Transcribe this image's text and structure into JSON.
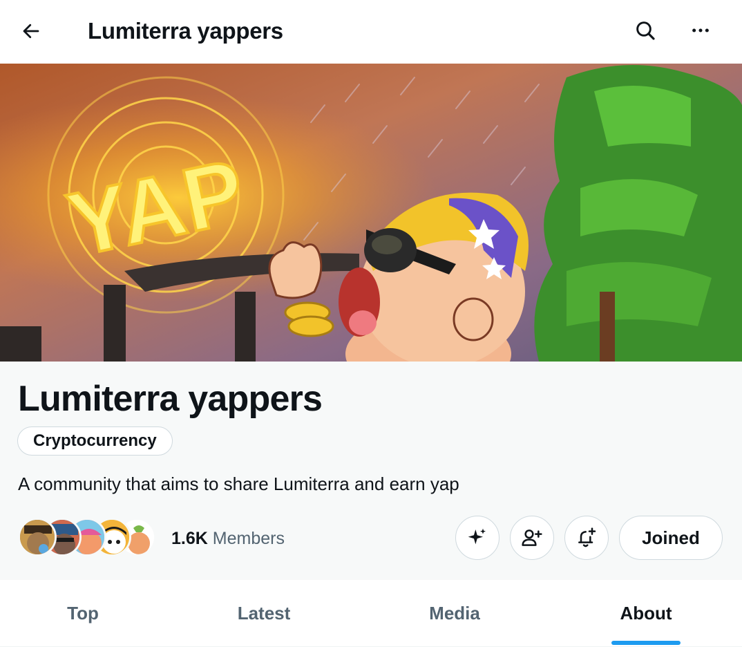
{
  "header": {
    "title": "Lumiterra yappers",
    "back_icon": "arrow-left-icon",
    "search_icon": "search-icon",
    "more_icon": "more-horizontal-icon"
  },
  "banner": {
    "sign_text": "YAP"
  },
  "community": {
    "name": "Lumiterra yappers",
    "topic": "Cryptocurrency",
    "description": "A community that aims to share Lumiterra and earn yap",
    "members_count": "1.6K",
    "members_label": "Members",
    "joined_label": "Joined"
  },
  "actions": {
    "sparkle_icon": "sparkle-icon",
    "invite_icon": "add-user-icon",
    "notify_icon": "bell-plus-icon"
  },
  "tabs": [
    {
      "label": "Top",
      "active": false
    },
    {
      "label": "Latest",
      "active": false
    },
    {
      "label": "Media",
      "active": false
    },
    {
      "label": "About",
      "active": true
    }
  ],
  "colors": {
    "accent": "#1d9bf0",
    "text_primary": "#0f1419",
    "text_secondary": "#536471",
    "border": "#cfd9de",
    "info_bg": "#f7f9f9"
  }
}
